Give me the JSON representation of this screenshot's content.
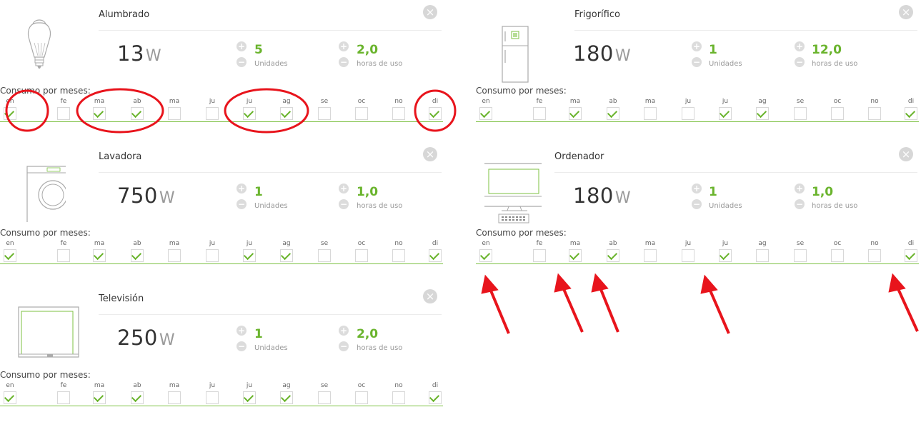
{
  "months_header": "Consumo por meses:",
  "month_labels": [
    "en",
    "fe",
    "ma",
    "ab",
    "ma",
    "ju",
    "ju",
    "ag",
    "se",
    "oc",
    "no",
    "di"
  ],
  "units_label": "Unidades",
  "hours_label": "horas de uso",
  "watt_unit": "W",
  "appliances": [
    {
      "name": "Alumbrado",
      "watts": "13",
      "units": "5",
      "hours": "2,0",
      "months": [
        true,
        false,
        true,
        true,
        false,
        false,
        true,
        true,
        false,
        false,
        false,
        true
      ]
    },
    {
      "name": "Frigorífico",
      "watts": "180",
      "units": "1",
      "hours": "12,0",
      "months": [
        true,
        false,
        true,
        true,
        false,
        false,
        true,
        true,
        false,
        false,
        false,
        true
      ]
    },
    {
      "name": "Lavadora",
      "watts": "750",
      "units": "1",
      "hours": "1,0",
      "months": [
        true,
        false,
        true,
        true,
        false,
        false,
        true,
        true,
        false,
        false,
        false,
        true
      ]
    },
    {
      "name": "Ordenador",
      "watts": "180",
      "units": "1",
      "hours": "1,0",
      "months": [
        true,
        false,
        true,
        true,
        false,
        false,
        true,
        false,
        false,
        false,
        false,
        true
      ]
    },
    {
      "name": "Televisión",
      "watts": "250",
      "units": "1",
      "hours": "2,0",
      "months": [
        true,
        false,
        true,
        true,
        false,
        false,
        true,
        true,
        false,
        false,
        false,
        true
      ]
    }
  ],
  "colors": {
    "accent": "#6ab42d",
    "annotation": "#e8141c"
  }
}
